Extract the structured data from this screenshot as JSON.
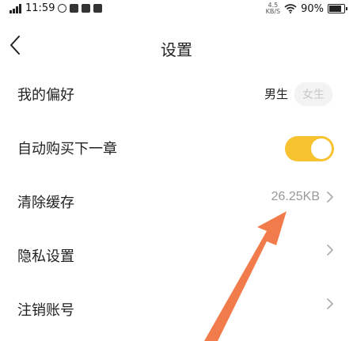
{
  "status_bar": {
    "time": "11:59",
    "network_speed_top": "4.5",
    "network_speed_bottom": "KB/S",
    "battery": "90%",
    "battery_level": 0.9
  },
  "nav": {
    "title": "设置"
  },
  "rows": {
    "preference": {
      "label": "我的偏好",
      "male": "男生",
      "female": "女生"
    },
    "auto_buy": {
      "label": "自动购买下一章",
      "on": true
    },
    "clear_cache": {
      "label": "清除缓存",
      "value": "26.25KB"
    },
    "privacy": {
      "label": "隐私设置"
    },
    "cancel_account": {
      "label": "注销账号"
    }
  },
  "colors": {
    "accent": "#f7c330",
    "arrow": "#f27b4b"
  }
}
